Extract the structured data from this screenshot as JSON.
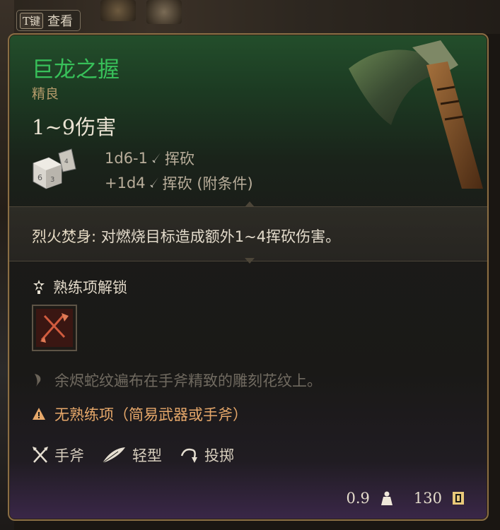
{
  "hotkey": {
    "key": "T键",
    "label": "查看"
  },
  "item": {
    "name": "巨龙之握",
    "rarity": "精良",
    "damage": "1~9伤害",
    "damage_lines": [
      {
        "dice": "1d6-1",
        "type": "挥砍"
      },
      {
        "dice": "+1d4",
        "type": "挥砍 (附条件)"
      }
    ],
    "special": {
      "name": "烈火焚身:",
      "text": " 对燃烧目标造成额外1~4挥砍伤害。"
    },
    "proficiency_unlock_label": "熟练项解锁",
    "flavor": "余烬蛇纹遍布在手斧精致的雕刻花纹上。",
    "warning": "无熟练项（简易武器或手斧）",
    "properties": [
      {
        "icon": "handaxe-icon",
        "label": "手斧"
      },
      {
        "icon": "feather-icon",
        "label": "轻型"
      },
      {
        "icon": "throw-icon",
        "label": "投掷"
      }
    ],
    "weight": "0.9",
    "value": "130"
  },
  "colors": {
    "name": "#38c05a",
    "rarity": "#b59b6b",
    "warning": "#e7a86a",
    "border": "#8a6e44"
  }
}
